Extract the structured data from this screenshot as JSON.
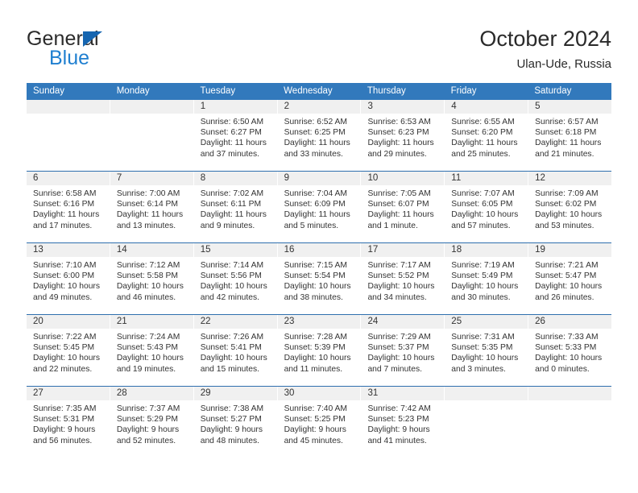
{
  "brand": {
    "line1": "General",
    "line2": "Blue",
    "triangle_color": "#1565b0",
    "blue_text_color": "#1f7fd0"
  },
  "header": {
    "title": "October 2024",
    "subtitle": "Ulan-Ude, Russia"
  },
  "calendar": {
    "header_bg": "#3279bc",
    "daynum_bg": "#f0f0f0",
    "weekday_headers": [
      "Sunday",
      "Monday",
      "Tuesday",
      "Wednesday",
      "Thursday",
      "Friday",
      "Saturday"
    ],
    "weeks": [
      [
        {
          "day": "",
          "sunrise": "",
          "sunset": "",
          "daylight1": "",
          "daylight2": ""
        },
        {
          "day": "",
          "sunrise": "",
          "sunset": "",
          "daylight1": "",
          "daylight2": ""
        },
        {
          "day": "1",
          "sunrise": "Sunrise: 6:50 AM",
          "sunset": "Sunset: 6:27 PM",
          "daylight1": "Daylight: 11 hours",
          "daylight2": "and 37 minutes."
        },
        {
          "day": "2",
          "sunrise": "Sunrise: 6:52 AM",
          "sunset": "Sunset: 6:25 PM",
          "daylight1": "Daylight: 11 hours",
          "daylight2": "and 33 minutes."
        },
        {
          "day": "3",
          "sunrise": "Sunrise: 6:53 AM",
          "sunset": "Sunset: 6:23 PM",
          "daylight1": "Daylight: 11 hours",
          "daylight2": "and 29 minutes."
        },
        {
          "day": "4",
          "sunrise": "Sunrise: 6:55 AM",
          "sunset": "Sunset: 6:20 PM",
          "daylight1": "Daylight: 11 hours",
          "daylight2": "and 25 minutes."
        },
        {
          "day": "5",
          "sunrise": "Sunrise: 6:57 AM",
          "sunset": "Sunset: 6:18 PM",
          "daylight1": "Daylight: 11 hours",
          "daylight2": "and 21 minutes."
        }
      ],
      [
        {
          "day": "6",
          "sunrise": "Sunrise: 6:58 AM",
          "sunset": "Sunset: 6:16 PM",
          "daylight1": "Daylight: 11 hours",
          "daylight2": "and 17 minutes."
        },
        {
          "day": "7",
          "sunrise": "Sunrise: 7:00 AM",
          "sunset": "Sunset: 6:14 PM",
          "daylight1": "Daylight: 11 hours",
          "daylight2": "and 13 minutes."
        },
        {
          "day": "8",
          "sunrise": "Sunrise: 7:02 AM",
          "sunset": "Sunset: 6:11 PM",
          "daylight1": "Daylight: 11 hours",
          "daylight2": "and 9 minutes."
        },
        {
          "day": "9",
          "sunrise": "Sunrise: 7:04 AM",
          "sunset": "Sunset: 6:09 PM",
          "daylight1": "Daylight: 11 hours",
          "daylight2": "and 5 minutes."
        },
        {
          "day": "10",
          "sunrise": "Sunrise: 7:05 AM",
          "sunset": "Sunset: 6:07 PM",
          "daylight1": "Daylight: 11 hours",
          "daylight2": "and 1 minute."
        },
        {
          "day": "11",
          "sunrise": "Sunrise: 7:07 AM",
          "sunset": "Sunset: 6:05 PM",
          "daylight1": "Daylight: 10 hours",
          "daylight2": "and 57 minutes."
        },
        {
          "day": "12",
          "sunrise": "Sunrise: 7:09 AM",
          "sunset": "Sunset: 6:02 PM",
          "daylight1": "Daylight: 10 hours",
          "daylight2": "and 53 minutes."
        }
      ],
      [
        {
          "day": "13",
          "sunrise": "Sunrise: 7:10 AM",
          "sunset": "Sunset: 6:00 PM",
          "daylight1": "Daylight: 10 hours",
          "daylight2": "and 49 minutes."
        },
        {
          "day": "14",
          "sunrise": "Sunrise: 7:12 AM",
          "sunset": "Sunset: 5:58 PM",
          "daylight1": "Daylight: 10 hours",
          "daylight2": "and 46 minutes."
        },
        {
          "day": "15",
          "sunrise": "Sunrise: 7:14 AM",
          "sunset": "Sunset: 5:56 PM",
          "daylight1": "Daylight: 10 hours",
          "daylight2": "and 42 minutes."
        },
        {
          "day": "16",
          "sunrise": "Sunrise: 7:15 AM",
          "sunset": "Sunset: 5:54 PM",
          "daylight1": "Daylight: 10 hours",
          "daylight2": "and 38 minutes."
        },
        {
          "day": "17",
          "sunrise": "Sunrise: 7:17 AM",
          "sunset": "Sunset: 5:52 PM",
          "daylight1": "Daylight: 10 hours",
          "daylight2": "and 34 minutes."
        },
        {
          "day": "18",
          "sunrise": "Sunrise: 7:19 AM",
          "sunset": "Sunset: 5:49 PM",
          "daylight1": "Daylight: 10 hours",
          "daylight2": "and 30 minutes."
        },
        {
          "day": "19",
          "sunrise": "Sunrise: 7:21 AM",
          "sunset": "Sunset: 5:47 PM",
          "daylight1": "Daylight: 10 hours",
          "daylight2": "and 26 minutes."
        }
      ],
      [
        {
          "day": "20",
          "sunrise": "Sunrise: 7:22 AM",
          "sunset": "Sunset: 5:45 PM",
          "daylight1": "Daylight: 10 hours",
          "daylight2": "and 22 minutes."
        },
        {
          "day": "21",
          "sunrise": "Sunrise: 7:24 AM",
          "sunset": "Sunset: 5:43 PM",
          "daylight1": "Daylight: 10 hours",
          "daylight2": "and 19 minutes."
        },
        {
          "day": "22",
          "sunrise": "Sunrise: 7:26 AM",
          "sunset": "Sunset: 5:41 PM",
          "daylight1": "Daylight: 10 hours",
          "daylight2": "and 15 minutes."
        },
        {
          "day": "23",
          "sunrise": "Sunrise: 7:28 AM",
          "sunset": "Sunset: 5:39 PM",
          "daylight1": "Daylight: 10 hours",
          "daylight2": "and 11 minutes."
        },
        {
          "day": "24",
          "sunrise": "Sunrise: 7:29 AM",
          "sunset": "Sunset: 5:37 PM",
          "daylight1": "Daylight: 10 hours",
          "daylight2": "and 7 minutes."
        },
        {
          "day": "25",
          "sunrise": "Sunrise: 7:31 AM",
          "sunset": "Sunset: 5:35 PM",
          "daylight1": "Daylight: 10 hours",
          "daylight2": "and 3 minutes."
        },
        {
          "day": "26",
          "sunrise": "Sunrise: 7:33 AM",
          "sunset": "Sunset: 5:33 PM",
          "daylight1": "Daylight: 10 hours",
          "daylight2": "and 0 minutes."
        }
      ],
      [
        {
          "day": "27",
          "sunrise": "Sunrise: 7:35 AM",
          "sunset": "Sunset: 5:31 PM",
          "daylight1": "Daylight: 9 hours",
          "daylight2": "and 56 minutes."
        },
        {
          "day": "28",
          "sunrise": "Sunrise: 7:37 AM",
          "sunset": "Sunset: 5:29 PM",
          "daylight1": "Daylight: 9 hours",
          "daylight2": "and 52 minutes."
        },
        {
          "day": "29",
          "sunrise": "Sunrise: 7:38 AM",
          "sunset": "Sunset: 5:27 PM",
          "daylight1": "Daylight: 9 hours",
          "daylight2": "and 48 minutes."
        },
        {
          "day": "30",
          "sunrise": "Sunrise: 7:40 AM",
          "sunset": "Sunset: 5:25 PM",
          "daylight1": "Daylight: 9 hours",
          "daylight2": "and 45 minutes."
        },
        {
          "day": "31",
          "sunrise": "Sunrise: 7:42 AM",
          "sunset": "Sunset: 5:23 PM",
          "daylight1": "Daylight: 9 hours",
          "daylight2": "and 41 minutes."
        },
        {
          "day": "",
          "sunrise": "",
          "sunset": "",
          "daylight1": "",
          "daylight2": ""
        },
        {
          "day": "",
          "sunrise": "",
          "sunset": "",
          "daylight1": "",
          "daylight2": ""
        }
      ]
    ]
  }
}
